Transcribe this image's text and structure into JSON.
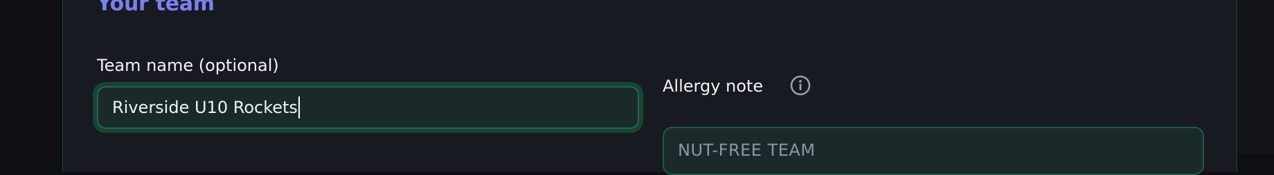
{
  "section": {
    "title": "Your team"
  },
  "team_name": {
    "label": "Team name (optional)",
    "value": "Riverside U10 Rockets"
  },
  "allergy_note": {
    "label": "Allergy note",
    "info_icon": "info-icon",
    "placeholder": "NUT-FREE TEAM"
  },
  "colors": {
    "accent": "#7b80ee",
    "card_background": "#181a22",
    "input_background": "#1a2a2b",
    "focus_border": "#236848"
  }
}
